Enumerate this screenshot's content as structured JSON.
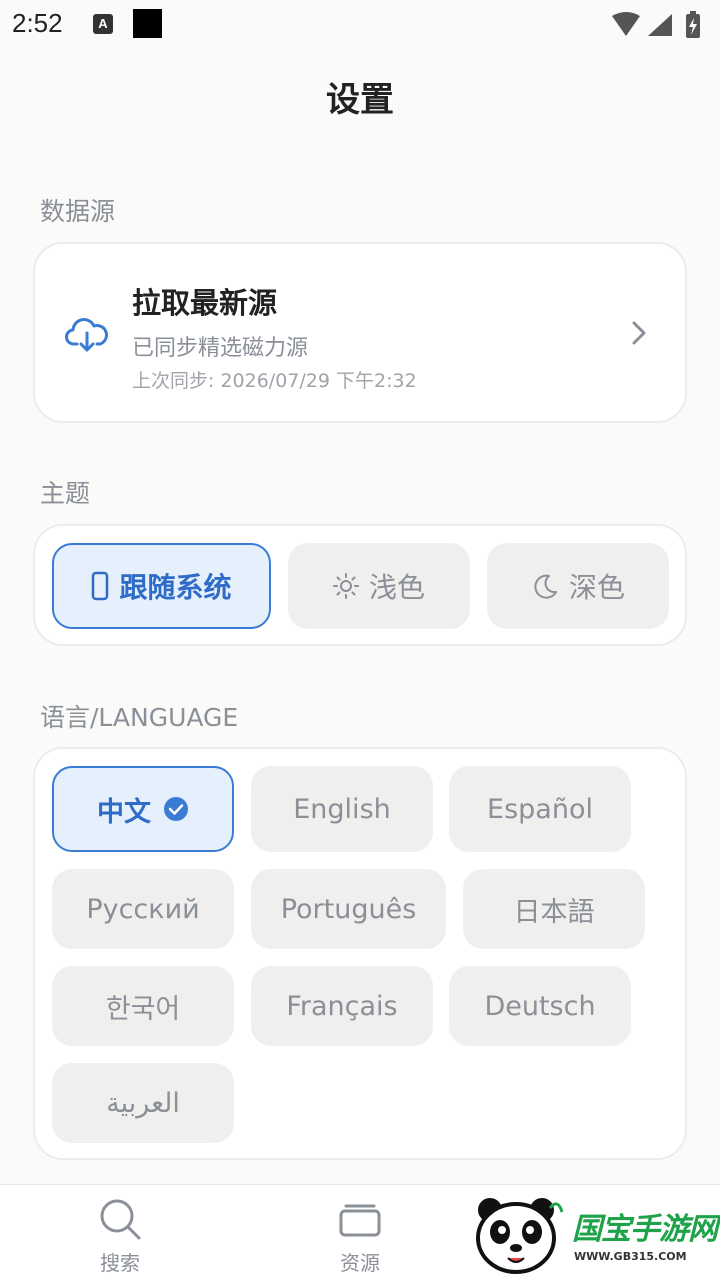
{
  "status_bar": {
    "time": "2:52",
    "a_badge": "A"
  },
  "page": {
    "title": "设置"
  },
  "data_source": {
    "section_label": "数据源",
    "title": "拉取最新源",
    "subtitle": "已同步精选磁力源",
    "last_sync": "上次同步: 2026/07/29 下午2:32"
  },
  "theme": {
    "section_label": "主题",
    "options": [
      {
        "label": "跟随系统",
        "icon": "phone-icon",
        "selected": true
      },
      {
        "label": "浅色",
        "icon": "sun-icon",
        "selected": false
      },
      {
        "label": "深色",
        "icon": "moon-icon",
        "selected": false
      }
    ]
  },
  "language": {
    "section_label": "语言/LANGUAGE",
    "options": [
      {
        "label": "中文",
        "selected": true
      },
      {
        "label": "English",
        "selected": false
      },
      {
        "label": "Español",
        "selected": false
      },
      {
        "label": "Русский",
        "selected": false
      },
      {
        "label": "Português",
        "selected": false
      },
      {
        "label": "日本語",
        "selected": false
      },
      {
        "label": "한국어",
        "selected": false
      },
      {
        "label": "Français",
        "selected": false
      },
      {
        "label": "Deutsch",
        "selected": false
      },
      {
        "label": "العربية",
        "selected": false
      }
    ]
  },
  "bottom_nav": {
    "items": [
      {
        "label": "搜索",
        "icon": "search-icon"
      },
      {
        "label": "资源",
        "icon": "stack-icon"
      }
    ]
  },
  "watermark": {
    "text": "国宝手游网",
    "url": "WWW.GB315.COM"
  },
  "colors": {
    "accent": "#3a7bd5",
    "accent_bg": "#e6effc",
    "muted": "#8a8f98",
    "pill_bg": "#f0efed"
  }
}
